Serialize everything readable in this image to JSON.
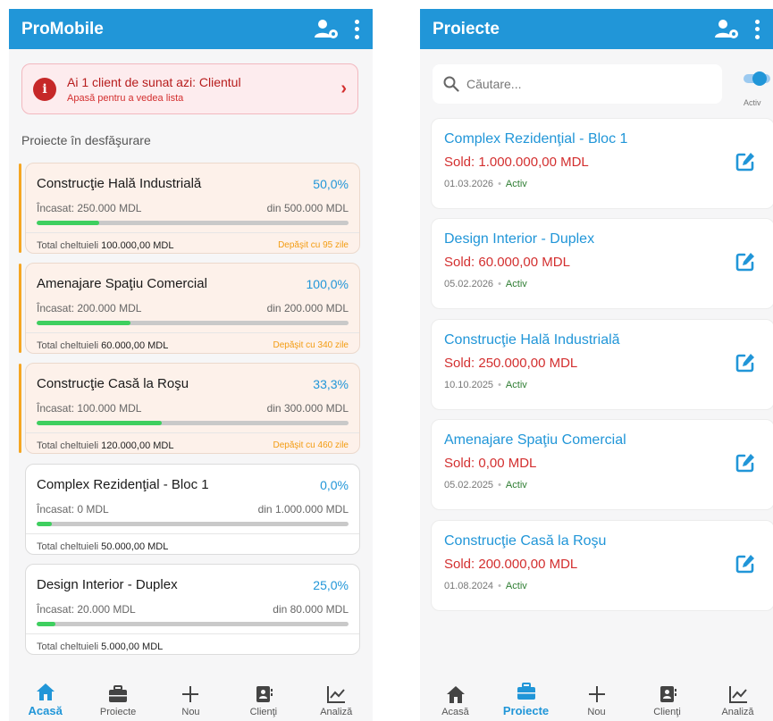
{
  "left": {
    "header": {
      "title": "ProMobile"
    },
    "alert": {
      "title": "Ai 1 client de sunat azi: Clientul",
      "subtitle": "Apasă pentru a vedea lista",
      "chevron": "›"
    },
    "section_label": "Proiecte în desfăşurare",
    "projects": [
      {
        "name": "Construcţie Hală Industrială",
        "percent": "50,0%",
        "progress": 0.2,
        "collected": "Încasat: 250.000 MDL",
        "total": "din 500.000 MDL",
        "expenses_label": "Total cheltuieli",
        "expenses": "100.000,00 MDL",
        "overdue": "Depăşit cu 95 zile"
      },
      {
        "name": "Amenajare Spaţiu Comercial",
        "percent": "100,0%",
        "progress": 0.3,
        "collected": "Încasat: 200.000 MDL",
        "total": "din 200.000 MDL",
        "expenses_label": "Total cheltuieli",
        "expenses": "60.000,00 MDL",
        "overdue": "Depăşit cu 340 zile"
      },
      {
        "name": "Construcţie Casă la Roşu",
        "percent": "33,3%",
        "progress": 0.4,
        "collected": "Încasat: 100.000 MDL",
        "total": "din 300.000 MDL",
        "expenses_label": "Total cheltuieli",
        "expenses": "120.000,00 MDL",
        "overdue": "Depăşit cu 460 zile"
      },
      {
        "name": "Complex Rezidenţial - Bloc 1",
        "percent": "0,0%",
        "progress": 0.05,
        "collected": "Încasat: 0 MDL",
        "total": "din 1.000.000 MDL",
        "expenses_label": "Total cheltuieli",
        "expenses": "50.000,00 MDL",
        "overdue": ""
      },
      {
        "name": "Design Interior - Duplex",
        "percent": "25,0%",
        "progress": 0.06,
        "collected": "Încasat: 20.000 MDL",
        "total": "din 80.000 MDL",
        "expenses_label": "Total cheltuieli",
        "expenses": "5.000,00 MDL",
        "overdue": ""
      }
    ],
    "nav": [
      {
        "label": "Acasă",
        "icon": "home-icon",
        "active": true
      },
      {
        "label": "Proiecte",
        "icon": "briefcase-icon",
        "active": false
      },
      {
        "label": "Nou",
        "icon": "plus-icon",
        "active": false
      },
      {
        "label": "Clienţi",
        "icon": "contacts-icon",
        "active": false
      },
      {
        "label": "Analiză",
        "icon": "chart-icon",
        "active": false
      }
    ]
  },
  "right": {
    "header": {
      "title": "Proiecte"
    },
    "search": {
      "placeholder": "Căutare..."
    },
    "toggle": {
      "label": "Activ",
      "on": true
    },
    "projects": [
      {
        "name": "Complex Rezidenţial - Bloc 1",
        "sold": "Sold: 1.000.000,00 MDL",
        "date": "01.03.2026",
        "status": "Activ"
      },
      {
        "name": "Design Interior - Duplex",
        "sold": "Sold: 60.000,00 MDL",
        "date": "05.02.2026",
        "status": "Activ"
      },
      {
        "name": "Construcţie Hală Industrială",
        "sold": "Sold: 250.000,00 MDL",
        "date": "10.10.2025",
        "status": "Activ"
      },
      {
        "name": "Amenajare Spaţiu Comercial",
        "sold": "Sold: 0,00 MDL",
        "date": "05.02.2025",
        "status": "Activ"
      },
      {
        "name": "Construcţie Casă la Roşu",
        "sold": "Sold: 200.000,00 MDL",
        "date": "01.08.2024",
        "status": "Activ"
      }
    ],
    "nav": [
      {
        "label": "Acasă",
        "icon": "home-icon",
        "active": false
      },
      {
        "label": "Proiecte",
        "icon": "briefcase-icon",
        "active": true
      },
      {
        "label": "Nou",
        "icon": "plus-icon",
        "active": false
      },
      {
        "label": "Clienţi",
        "icon": "contacts-icon",
        "active": false
      },
      {
        "label": "Analiză",
        "icon": "chart-icon",
        "active": false
      }
    ]
  },
  "colors": {
    "primary": "#2196d8",
    "danger": "#d32f2f",
    "success": "#3ecf5f",
    "warning": "#f5a623"
  }
}
